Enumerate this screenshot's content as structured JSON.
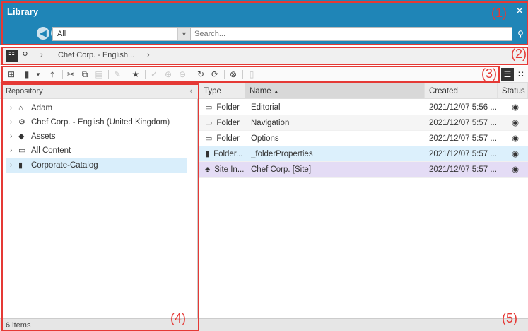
{
  "header": {
    "title": "Library",
    "close_glyph": "✕",
    "back_glyph": "◀",
    "forward_glyph": "▶",
    "filter_value": "All",
    "search_placeholder": "Search..."
  },
  "breadcrumb": {
    "path_item": "Chef Corp. - English..."
  },
  "repository": {
    "header_label": "Repository",
    "items": [
      {
        "label": "Adam",
        "icon": "home-icon"
      },
      {
        "label": "Chef Corp. - English (United Kingdom)",
        "icon": "site-icon"
      },
      {
        "label": "Assets",
        "icon": "assets-icon"
      },
      {
        "label": "All Content",
        "icon": "folder-icon"
      },
      {
        "label": "Corporate-Catalog",
        "icon": "catalog-icon"
      }
    ],
    "footer": "6 items"
  },
  "table": {
    "columns": [
      "Type",
      "Name",
      "Created",
      "Status"
    ],
    "sort_indicator": "▲",
    "rows": [
      {
        "type": "Folder",
        "name": "Editorial",
        "created": "2021/12/07 5:56 ...",
        "icon": "folder-icon"
      },
      {
        "type": "Folder",
        "name": "Navigation",
        "created": "2021/12/07 5:57 ...",
        "icon": "folder-icon"
      },
      {
        "type": "Folder",
        "name": "Options",
        "created": "2021/12/07 5:57 ...",
        "icon": "folder-icon"
      },
      {
        "type": "Folder...",
        "name": "_folderProperties",
        "created": "2021/12/07 5:57 ...",
        "icon": "folder-properties-icon"
      },
      {
        "type": "Site In...",
        "name": "Chef Corp. [Site]",
        "created": "2021/12/07 5:57 ...",
        "icon": "site-indicator-icon"
      }
    ]
  },
  "callouts": [
    "(1)",
    "(2)",
    "(3)",
    "(4)",
    "(5)"
  ],
  "colors": {
    "header": "#1f85b7",
    "callout": "#e53935",
    "selected_row": "#dcf0fc",
    "site_row": "#e4dcf5"
  }
}
